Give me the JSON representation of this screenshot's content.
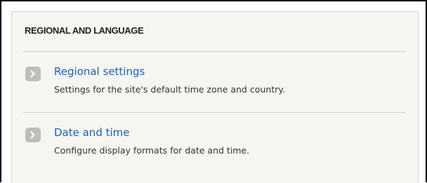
{
  "section": {
    "title": "REGIONAL AND LANGUAGE",
    "items": [
      {
        "label": "Regional settings",
        "description": "Settings for the site's default time zone and country."
      },
      {
        "label": "Date and time",
        "description": "Configure display formats for date and time."
      }
    ]
  },
  "icons": {
    "item_bullet": "chevron-right-icon"
  },
  "colors": {
    "link": "#1a62b6",
    "panel_bg": "#f5f5f2",
    "bullet_bg": "#bdbdba"
  }
}
